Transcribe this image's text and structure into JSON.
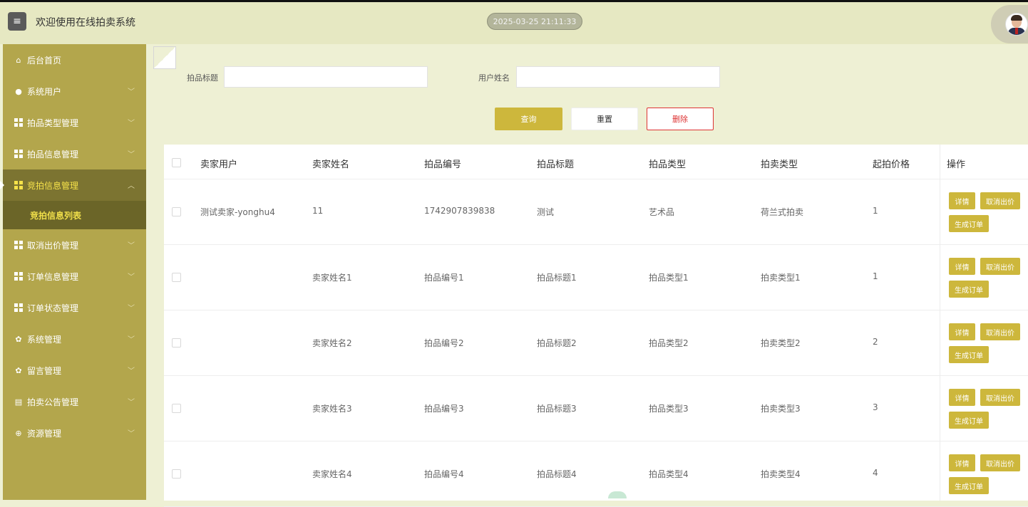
{
  "header": {
    "title": "欢迎使用在线拍卖系统",
    "datetime": "2025-03-25 21:11:33"
  },
  "sidebar": {
    "items": [
      {
        "label": "后台首页",
        "icon": "home-icon",
        "chevron": false
      },
      {
        "label": "系统用户",
        "icon": "user-icon",
        "chevron": true
      },
      {
        "label": "拍品类型管理",
        "icon": "grid-icon",
        "chevron": true
      },
      {
        "label": "拍品信息管理",
        "icon": "grid-icon",
        "chevron": true
      },
      {
        "label": "竞拍信息管理",
        "icon": "grid-icon",
        "chevron": true,
        "active": true
      },
      {
        "label": "取消出价管理",
        "icon": "grid-icon",
        "chevron": true
      },
      {
        "label": "订单信息管理",
        "icon": "grid-icon",
        "chevron": true
      },
      {
        "label": "订单状态管理",
        "icon": "grid-icon",
        "chevron": true
      },
      {
        "label": "系统管理",
        "icon": "gear-icon",
        "chevron": true
      },
      {
        "label": "留言管理",
        "icon": "gear-icon",
        "chevron": true
      },
      {
        "label": "拍卖公告管理",
        "icon": "document-icon",
        "chevron": true
      },
      {
        "label": "资源管理",
        "icon": "plus-circle-icon",
        "chevron": true
      }
    ],
    "sub_item": "竞拍信息列表"
  },
  "search": {
    "field1_label": "拍品标题",
    "field1_value": "",
    "field2_label": "用户姓名",
    "field2_value": "",
    "query_label": "查询",
    "reset_label": "重置",
    "delete_label": "删除"
  },
  "table": {
    "columns": [
      "卖家用户",
      "卖家姓名",
      "拍品编号",
      "拍品标题",
      "拍品类型",
      "拍卖类型",
      "起拍价格",
      "操作"
    ],
    "rows": [
      [
        "测试卖家-yonghu4",
        "11",
        "1742907839838",
        "测试",
        "艺术品",
        "荷兰式拍卖",
        "1"
      ],
      [
        "",
        "卖家姓名1",
        "拍品编号1",
        "拍品标题1",
        "拍品类型1",
        "拍卖类型1",
        "1"
      ],
      [
        "",
        "卖家姓名2",
        "拍品编号2",
        "拍品标题2",
        "拍品类型2",
        "拍卖类型2",
        "2"
      ],
      [
        "",
        "卖家姓名3",
        "拍品编号3",
        "拍品标题3",
        "拍品类型3",
        "拍卖类型3",
        "3"
      ],
      [
        "",
        "卖家姓名4",
        "拍品编号4",
        "拍品标题4",
        "拍品类型4",
        "拍卖类型4",
        "4"
      ]
    ],
    "actions": {
      "detail": "详情",
      "cancel_bid": "取消出价",
      "create_order": "生成订单"
    }
  },
  "colors": {
    "accent": "#cdb73c",
    "sidebar": "#b3a64c",
    "active": "#7c7431",
    "highlight": "#f6e24a"
  }
}
